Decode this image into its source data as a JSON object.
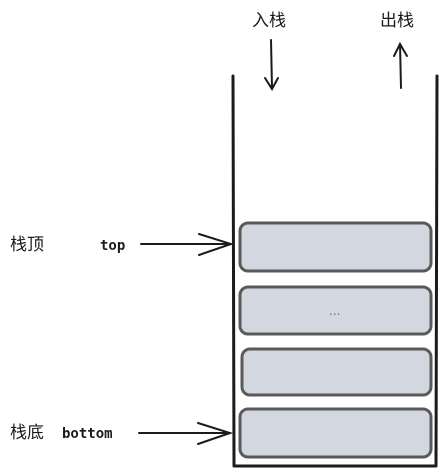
{
  "labels": {
    "push": "入栈",
    "pop": "出栈",
    "stack_top": "栈顶",
    "top": "top",
    "stack_bottom": "栈底",
    "bottom": "bottom"
  },
  "stack": {
    "block_count": 4,
    "middle_block_text": "..."
  },
  "colors": {
    "block_fill": "#d3d7e0",
    "block_stroke": "#5a5a5a",
    "line": "#1b1b1b"
  }
}
